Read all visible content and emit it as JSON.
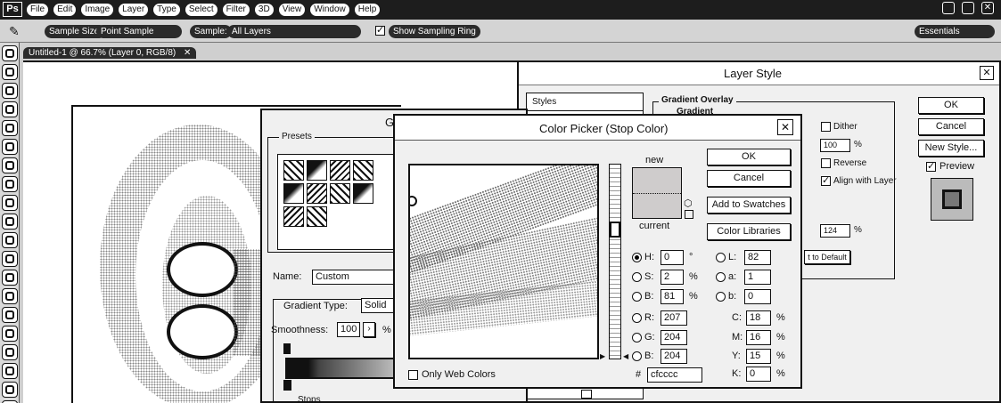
{
  "app": {
    "logo": "Ps"
  },
  "menubar": {
    "items": [
      "File",
      "Edit",
      "Image",
      "Layer",
      "Type",
      "Select",
      "Filter",
      "3D",
      "View",
      "Window",
      "Help"
    ]
  },
  "options_bar": {
    "sample_size_label": "Sample Size:",
    "sample_size_value": "Point Sample",
    "sample_label": "Sample:",
    "sample_value": "All Layers",
    "show_sampling_ring": "Show Sampling Ring",
    "workspace": "Essentials"
  },
  "document_tab": {
    "title": "Untitled-1 @ 66.7% (Layer 0, RGB/8)"
  },
  "layer_style": {
    "title": "Layer Style",
    "styles_label": "Styles",
    "group_title": "Gradient Overlay",
    "sub_title": "Gradient",
    "dither": "Dither",
    "opacity_value": "100",
    "opacity_unit": "%",
    "reverse": "Reverse",
    "align_with_layer": "Align with Layer",
    "scale_value": "124",
    "scale_unit": "%",
    "reset_default": "t to Default",
    "ok": "OK",
    "cancel": "Cancel",
    "new_style": "New Style...",
    "preview": "Preview"
  },
  "gradient_editor": {
    "title_partial": "G",
    "presets_label": "Presets",
    "name_label": "Name:",
    "name_value": "Custom",
    "gradient_type_label": "Gradient Type:",
    "gradient_type_value": "Solid",
    "smoothness_label": "Smoothness:",
    "smoothness_value": "100",
    "smoothness_unit": "%",
    "stops_label": "Stops"
  },
  "color_picker": {
    "title": "Color Picker (Stop Color)",
    "ok": "OK",
    "cancel": "Cancel",
    "add_to_swatches": "Add to Swatches",
    "color_libraries": "Color Libraries",
    "new_label": "new",
    "current_label": "current",
    "only_web_colors": "Only Web Colors",
    "hex_prefix": "#",
    "hex_value": "cfcccc",
    "hsb": [
      {
        "label": "H:",
        "value": "0",
        "unit": "°"
      },
      {
        "label": "S:",
        "value": "2",
        "unit": "%"
      },
      {
        "label": "B:",
        "value": "81",
        "unit": "%"
      }
    ],
    "rgb": [
      {
        "label": "R:",
        "value": "207"
      },
      {
        "label": "G:",
        "value": "204"
      },
      {
        "label": "B:",
        "value": "204"
      }
    ],
    "lab": [
      {
        "label": "L:",
        "value": "82"
      },
      {
        "label": "a:",
        "value": "1"
      },
      {
        "label": "b:",
        "value": "0"
      }
    ],
    "cmyk": [
      {
        "label": "C:",
        "value": "18",
        "unit": "%"
      },
      {
        "label": "M:",
        "value": "16",
        "unit": "%"
      },
      {
        "label": "Y:",
        "value": "15",
        "unit": "%"
      },
      {
        "label": "K:",
        "value": "0",
        "unit": "%"
      }
    ],
    "new_color": "#cfcccc",
    "current_color": "#cfcccc"
  }
}
